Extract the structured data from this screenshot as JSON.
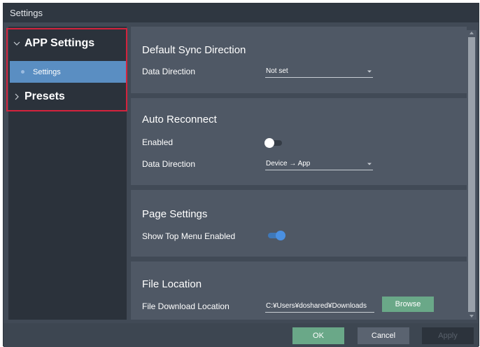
{
  "window": {
    "title": "Settings"
  },
  "sidebar": {
    "groups": [
      {
        "label": "APP Settings",
        "expanded": true
      },
      {
        "label": "Presets",
        "expanded": false
      }
    ],
    "items": [
      {
        "label": "Settings",
        "selected": true
      }
    ]
  },
  "panels": {
    "sync": {
      "title": "Default Sync Direction",
      "direction_label": "Data Direction",
      "direction_value": "Not set"
    },
    "reconnect": {
      "title": "Auto Reconnect",
      "enabled_label": "Enabled",
      "enabled": false,
      "direction_label": "Data Direction",
      "direction_value": "Device → App"
    },
    "page": {
      "title": "Page Settings",
      "top_menu_label": "Show Top Menu Enabled",
      "top_menu_enabled": true
    },
    "file": {
      "title": "File Location",
      "download_label": "File Download Location",
      "download_value": "C:¥Users¥doshared¥Downloads",
      "browse_label": "Browse"
    }
  },
  "footer": {
    "ok_label": "OK",
    "cancel_label": "Cancel",
    "apply_label": "Apply"
  },
  "colors": {
    "accent": "#5a8ec2",
    "toggle_on": "#4a90e2",
    "ok_button": "#6aa888",
    "window_bg": "#414a56",
    "panel_bg": "#4f5865",
    "sidebar_bg": "#2b323b",
    "highlight_border": "#d4233d"
  },
  "icons": {
    "group_expanded": "chevron-down-icon",
    "group_collapsed": "chevron-right-icon",
    "select": "caret-down-icon"
  }
}
